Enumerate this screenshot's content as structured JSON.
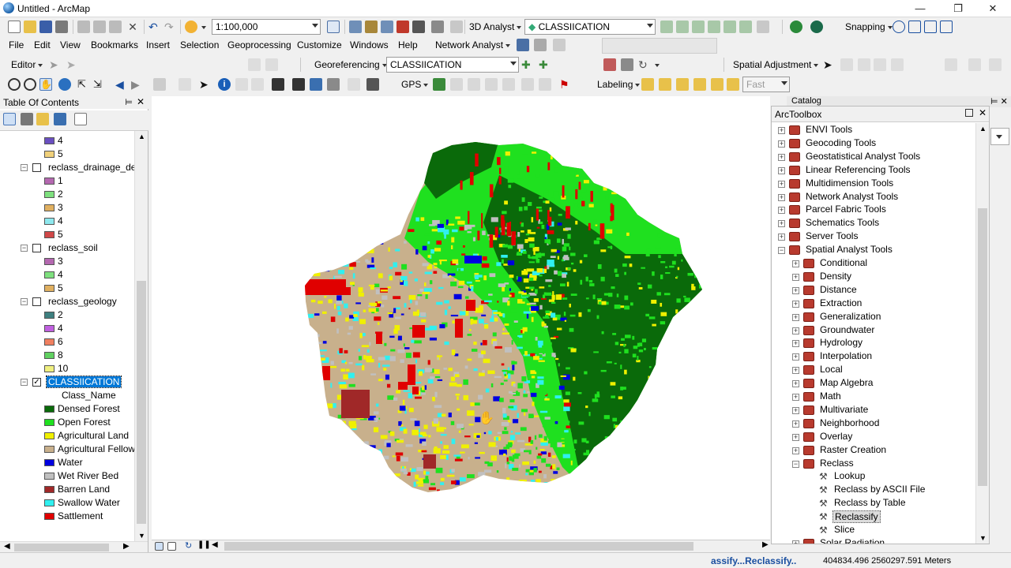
{
  "window": {
    "title": "Untitled - ArcMap"
  },
  "menu": [
    "File",
    "Edit",
    "View",
    "Bookmarks",
    "Insert",
    "Selection",
    "Geoprocessing",
    "Customize",
    "Windows",
    "Help"
  ],
  "network_analyst": "Network Analyst",
  "toolbar1": {
    "scale": "1:100,000",
    "analyst_3d": "3D Analyst",
    "layer_combo": "CLASSIICATION",
    "snapping": "Snapping"
  },
  "toolbar2": {
    "editor": "Editor",
    "georeferencing": "Georeferencing",
    "georef_layer": "CLASSIICATION",
    "spatial_adjustment": "Spatial Adjustment"
  },
  "toolbar3": {
    "gps": "GPS",
    "labeling": "Labeling",
    "fast": "Fast"
  },
  "toc": {
    "title": "Table Of Contents",
    "rows": [
      {
        "type": "class",
        "label": "4",
        "color": "#6a4fc0"
      },
      {
        "type": "class",
        "label": "5",
        "color": "#f0d07a"
      },
      {
        "type": "layer",
        "label": "reclass_drainage_dens",
        "checked": false
      },
      {
        "type": "class",
        "label": "1",
        "color": "#b468b0"
      },
      {
        "type": "class",
        "label": "2",
        "color": "#7ee07e"
      },
      {
        "type": "class",
        "label": "3",
        "color": "#e0b060"
      },
      {
        "type": "class",
        "label": "4",
        "color": "#8ee8ee"
      },
      {
        "type": "class",
        "label": "5",
        "color": "#d04848"
      },
      {
        "type": "layer",
        "label": "reclass_soil",
        "checked": false
      },
      {
        "type": "class",
        "label": "3",
        "color": "#b468b0"
      },
      {
        "type": "class",
        "label": "4",
        "color": "#7ee07e"
      },
      {
        "type": "class",
        "label": "5",
        "color": "#e0b060"
      },
      {
        "type": "layer",
        "label": "reclass_geology",
        "checked": false
      },
      {
        "type": "class",
        "label": "2",
        "color": "#3e8080"
      },
      {
        "type": "class",
        "label": "4",
        "color": "#c060e0"
      },
      {
        "type": "class",
        "label": "6",
        "color": "#f08060"
      },
      {
        "type": "class",
        "label": "8",
        "color": "#60d060"
      },
      {
        "type": "class",
        "label": "10",
        "color": "#f0f080"
      },
      {
        "type": "layer",
        "label": "CLASSIICATION",
        "checked": true,
        "selected": true
      },
      {
        "type": "field",
        "label": "Class_Name"
      },
      {
        "type": "class",
        "label": "Densed Forest",
        "color": "#0a6a0a"
      },
      {
        "type": "class",
        "label": "Open Forest",
        "color": "#1fe01f"
      },
      {
        "type": "class",
        "label": "Agricultural Land",
        "color": "#f0f000"
      },
      {
        "type": "class",
        "label": "Agricultural Fellow",
        "color": "#c8b08c"
      },
      {
        "type": "class",
        "label": "Water",
        "color": "#0000e0"
      },
      {
        "type": "class",
        "label": "Wet River Bed",
        "color": "#c0c0c0"
      },
      {
        "type": "class",
        "label": "Barren Land",
        "color": "#a02828"
      },
      {
        "type": "class",
        "label": "Swallow Water",
        "color": "#30f0f0"
      },
      {
        "type": "class",
        "label": "Sattlement",
        "color": "#e00000"
      }
    ]
  },
  "catalog": {
    "title": "Catalog"
  },
  "toolbox": {
    "title": "ArcToolbox",
    "items": [
      {
        "level": 0,
        "kind": "box",
        "label": "ENVI Tools",
        "exp": "+"
      },
      {
        "level": 0,
        "kind": "box",
        "label": "Geocoding Tools",
        "exp": "+"
      },
      {
        "level": 0,
        "kind": "box",
        "label": "Geostatistical Analyst Tools",
        "exp": "+"
      },
      {
        "level": 0,
        "kind": "box",
        "label": "Linear Referencing Tools",
        "exp": "+"
      },
      {
        "level": 0,
        "kind": "box",
        "label": "Multidimension Tools",
        "exp": "+"
      },
      {
        "level": 0,
        "kind": "box",
        "label": "Network Analyst Tools",
        "exp": "+"
      },
      {
        "level": 0,
        "kind": "box",
        "label": "Parcel Fabric Tools",
        "exp": "+"
      },
      {
        "level": 0,
        "kind": "box",
        "label": "Schematics Tools",
        "exp": "+"
      },
      {
        "level": 0,
        "kind": "box",
        "label": "Server Tools",
        "exp": "+"
      },
      {
        "level": 0,
        "kind": "box",
        "label": "Spatial Analyst Tools",
        "exp": "-"
      },
      {
        "level": 1,
        "kind": "set",
        "label": "Conditional",
        "exp": "+"
      },
      {
        "level": 1,
        "kind": "set",
        "label": "Density",
        "exp": "+"
      },
      {
        "level": 1,
        "kind": "set",
        "label": "Distance",
        "exp": "+"
      },
      {
        "level": 1,
        "kind": "set",
        "label": "Extraction",
        "exp": "+"
      },
      {
        "level": 1,
        "kind": "set",
        "label": "Generalization",
        "exp": "+"
      },
      {
        "level": 1,
        "kind": "set",
        "label": "Groundwater",
        "exp": "+"
      },
      {
        "level": 1,
        "kind": "set",
        "label": "Hydrology",
        "exp": "+"
      },
      {
        "level": 1,
        "kind": "set",
        "label": "Interpolation",
        "exp": "+"
      },
      {
        "level": 1,
        "kind": "set",
        "label": "Local",
        "exp": "+"
      },
      {
        "level": 1,
        "kind": "set",
        "label": "Map Algebra",
        "exp": "+"
      },
      {
        "level": 1,
        "kind": "set",
        "label": "Math",
        "exp": "+"
      },
      {
        "level": 1,
        "kind": "set",
        "label": "Multivariate",
        "exp": "+"
      },
      {
        "level": 1,
        "kind": "set",
        "label": "Neighborhood",
        "exp": "+"
      },
      {
        "level": 1,
        "kind": "set",
        "label": "Overlay",
        "exp": "+"
      },
      {
        "level": 1,
        "kind": "set",
        "label": "Raster Creation",
        "exp": "+"
      },
      {
        "level": 1,
        "kind": "set",
        "label": "Reclass",
        "exp": "-"
      },
      {
        "level": 2,
        "kind": "tool",
        "label": "Lookup"
      },
      {
        "level": 2,
        "kind": "tool",
        "label": "Reclass by ASCII File"
      },
      {
        "level": 2,
        "kind": "tool",
        "label": "Reclass by Table"
      },
      {
        "level": 2,
        "kind": "tool",
        "label": "Reclassify",
        "selected": true
      },
      {
        "level": 2,
        "kind": "tool",
        "label": "Slice"
      },
      {
        "level": 1,
        "kind": "set",
        "label": "Solar Radiation",
        "exp": "+"
      }
    ]
  },
  "status": {
    "message": "assify...Reclassify..",
    "coords": "404834.496  2560297.591 Meters"
  },
  "colors": {
    "densed_forest": "#0a6a0a",
    "open_forest": "#1fe01f",
    "agri": "#f0f000",
    "fellow": "#c8b08c",
    "water": "#0000e0",
    "wet": "#c0c0c0",
    "barren": "#a02828",
    "swallow": "#30f0f0",
    "settlement": "#e00000",
    "selection": "#0078d7"
  }
}
